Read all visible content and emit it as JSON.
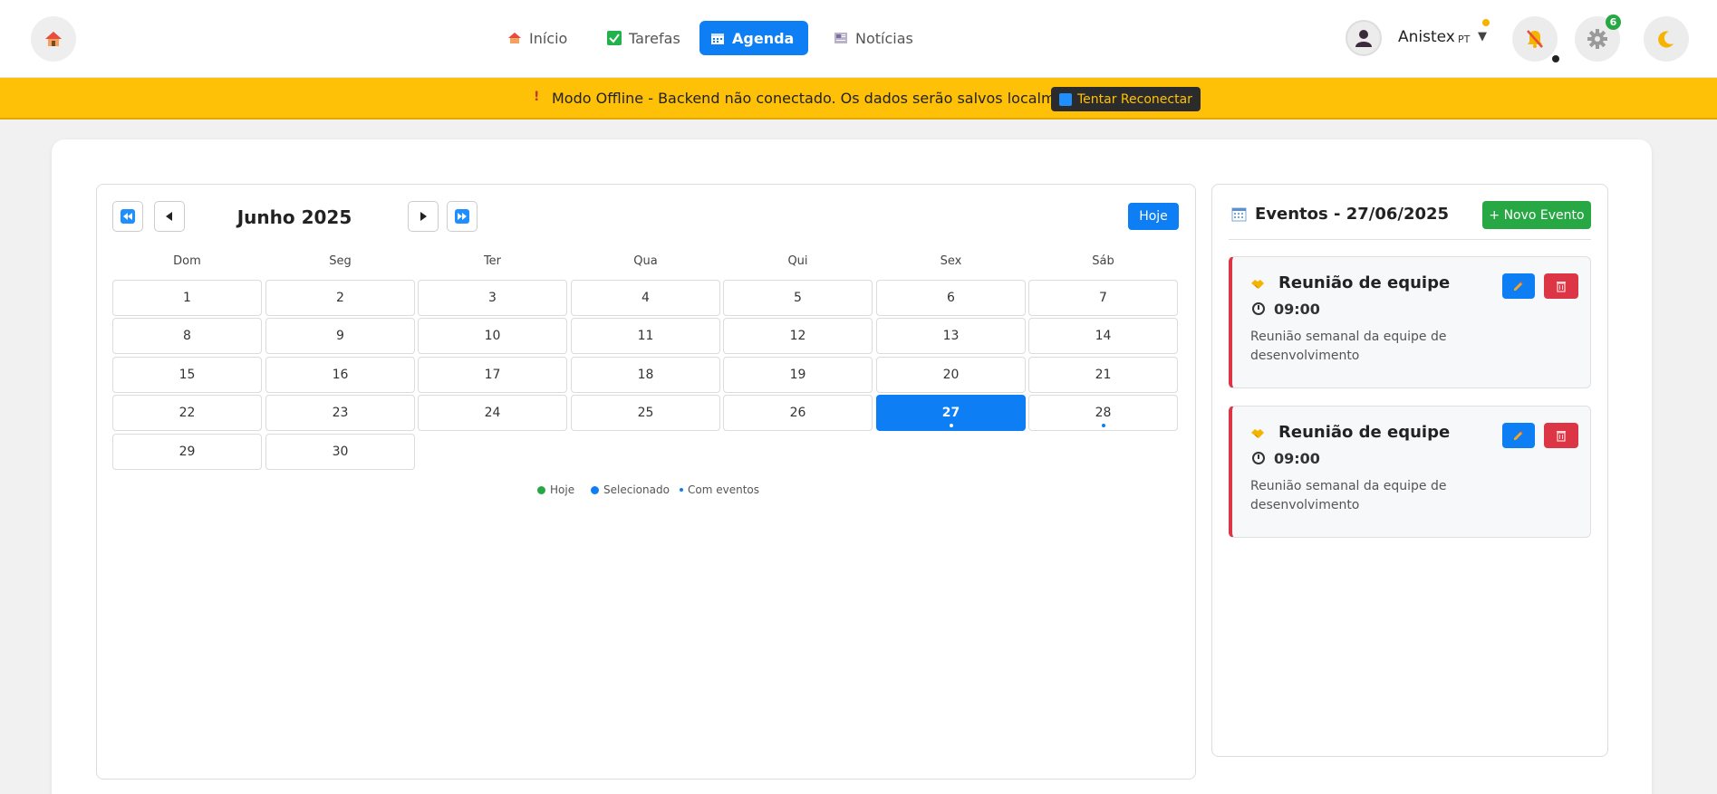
{
  "header": {
    "nav": [
      {
        "label": "Início",
        "icon": "house-icon"
      },
      {
        "label": "Tarefas",
        "icon": "checkbox-icon"
      },
      {
        "label": "Agenda",
        "icon": "calendar-icon",
        "active": true
      },
      {
        "label": "Notícias",
        "icon": "newspaper-icon"
      }
    ],
    "user": {
      "name": "Anistex",
      "lang": "PT"
    },
    "settings_badge": "6"
  },
  "banner": {
    "text": "Modo Offline - Backend não conectado. Os dados serão salvos localmente.",
    "reconnect_label": "Tentar Reconectar"
  },
  "calendar": {
    "month_label": "Junho 2025",
    "today_label": "Hoje",
    "weekdays": [
      "Dom",
      "Seg",
      "Ter",
      "Qua",
      "Qui",
      "Sex",
      "Sáb"
    ],
    "days": [
      "1",
      "2",
      "3",
      "4",
      "5",
      "6",
      "7",
      "8",
      "9",
      "10",
      "11",
      "12",
      "13",
      "14",
      "15",
      "16",
      "17",
      "18",
      "19",
      "20",
      "21",
      "22",
      "23",
      "24",
      "25",
      "26",
      "27",
      "28",
      "29",
      "30"
    ],
    "selected_day": "27",
    "event_days": [
      "27",
      "28"
    ],
    "legend": {
      "today": "Hoje",
      "selected": "Selecionado",
      "with_events": "Com eventos"
    }
  },
  "events": {
    "title": "Eventos - 27/06/2025",
    "new_label": "+ Novo Evento",
    "items": [
      {
        "name": "Reunião de equipe",
        "time": "09:00",
        "description": "Reunião semanal da equipe de desenvolvimento"
      },
      {
        "name": "Reunião de equipe",
        "time": "09:00",
        "description": "Reunião semanal da equipe de desenvolvimento"
      }
    ]
  },
  "colors": {
    "primary": "#0d7ef3",
    "success": "#28a745",
    "danger": "#dc3545",
    "warning": "#ffc107"
  }
}
